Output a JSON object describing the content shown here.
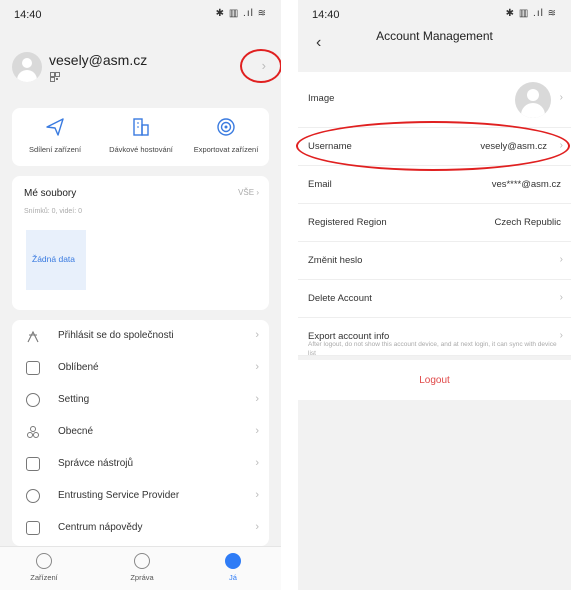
{
  "left": {
    "status": {
      "time": "14:40",
      "icons": "✱ ▥ .ıl ≋"
    },
    "profile": {
      "username": "vesely@asm.cz"
    },
    "actions": [
      {
        "label": "Sdílení zařízení"
      },
      {
        "label": "Dávkové hostování"
      },
      {
        "label": "Exportovat zařízení"
      }
    ],
    "files": {
      "title": "Mé soubory",
      "all": "VŠE",
      "summary": "Snímků: 0, videí: 0",
      "empty": "Žádná data"
    },
    "menu": [
      {
        "label": "Přihlásit se do společnosti",
        "icon": "company-icon"
      },
      {
        "label": "Oblíbené",
        "icon": "favorites-icon"
      },
      {
        "label": "Setting",
        "icon": "settings-icon"
      },
      {
        "label": "Obecné",
        "icon": "general-icon"
      },
      {
        "label": "Správce nástrojů",
        "icon": "toolbox-icon"
      },
      {
        "label": "Entrusting Service Provider",
        "icon": "service-provider-icon"
      },
      {
        "label": "Centrum nápovědy",
        "icon": "help-icon"
      }
    ],
    "tabs": [
      {
        "label": "Zařízení",
        "icon": "camera-icon"
      },
      {
        "label": "Zpráva",
        "icon": "message-icon"
      },
      {
        "label": "Já",
        "icon": "me-icon",
        "active": true
      }
    ]
  },
  "right": {
    "status": {
      "time": "14:40",
      "icons": "✱ ▥ .ıl ≋"
    },
    "title": "Account Management",
    "rows": {
      "image": "Image",
      "username": {
        "label": "Username",
        "value": "vesely@asm.cz"
      },
      "email": {
        "label": "Email",
        "value": "ves****@asm.cz"
      },
      "region": {
        "label": "Registered Region",
        "value": "Czech Republic"
      },
      "password": "Změnit heslo",
      "delete": "Delete Account",
      "export": "Export account info"
    },
    "hint": "After logout, do not show this account device, and at next login, it can sync with device list",
    "logout": "Logout"
  },
  "colors": {
    "accent": "#2f7cf6",
    "highlight_ring": "#e02020",
    "logout": "#e04848"
  }
}
